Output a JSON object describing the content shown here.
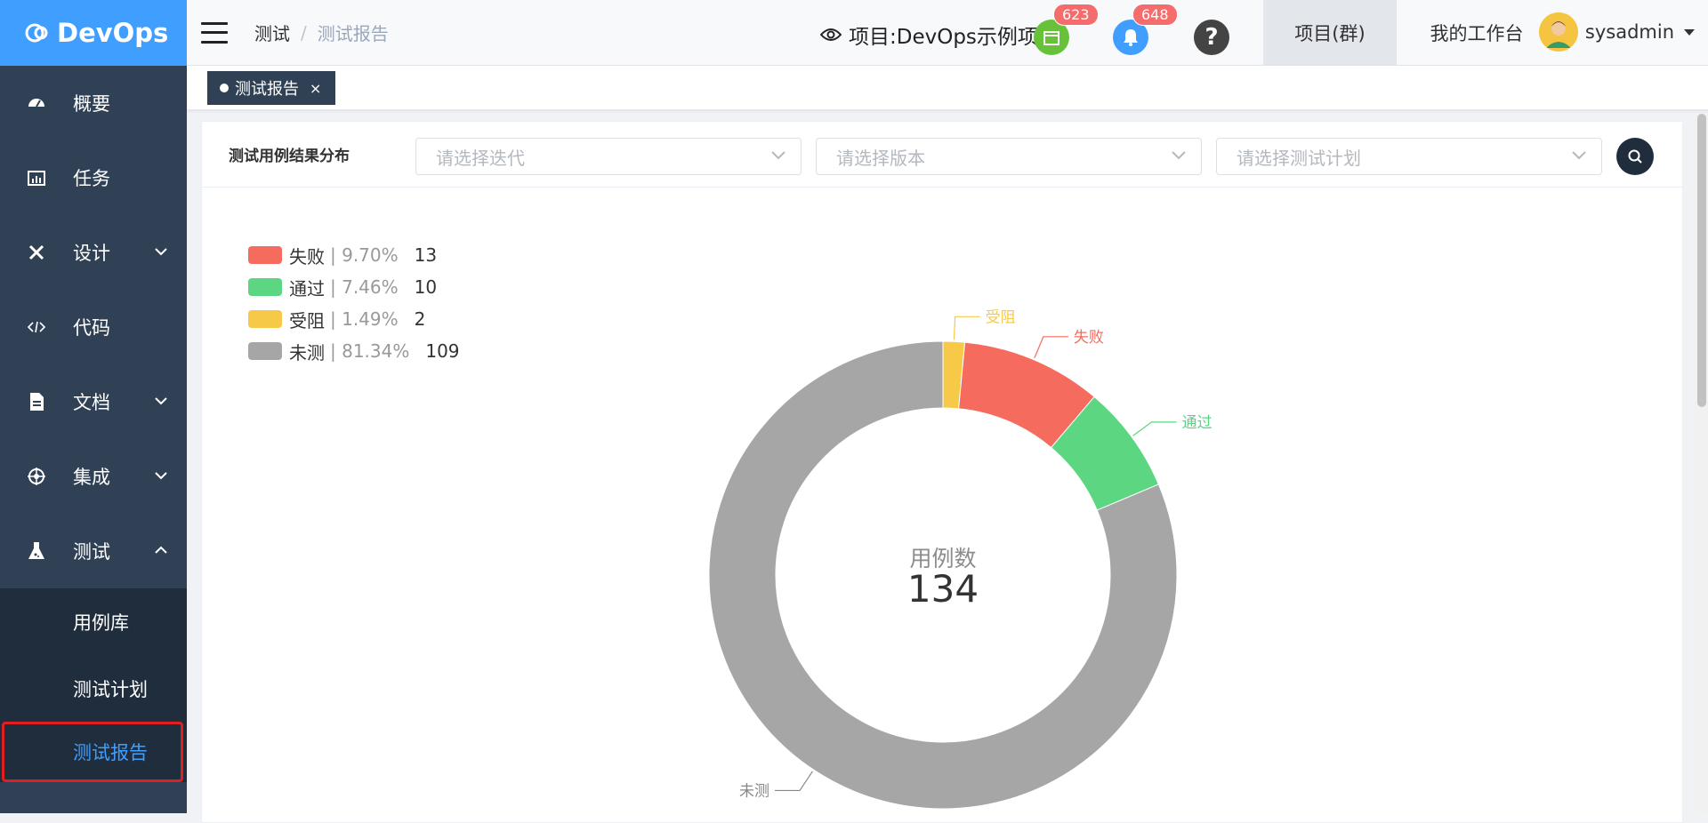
{
  "app": {
    "name": "DevOps"
  },
  "sidebar": {
    "items": [
      {
        "label": "概要",
        "icon": "dashboard-icon"
      },
      {
        "label": "任务",
        "icon": "task-icon"
      },
      {
        "label": "设计",
        "icon": "design-icon"
      },
      {
        "label": "代码",
        "icon": "code-icon"
      },
      {
        "label": "文档",
        "icon": "document-icon"
      },
      {
        "label": "集成",
        "icon": "integration-icon"
      },
      {
        "label": "测试",
        "icon": "flask-icon"
      }
    ],
    "test_submenu": [
      {
        "label": "用例库"
      },
      {
        "label": "测试计划"
      },
      {
        "label": "测试报告"
      }
    ]
  },
  "header": {
    "breadcrumb": [
      "测试",
      "测试报告"
    ],
    "project_prefix": "项目:",
    "project_name": "DevOps示例项目",
    "messages_badge": "623",
    "notifications_badge": "648",
    "project_group_label": "项目(群)",
    "workbench_label": "我的工作台",
    "username": "sysadmin"
  },
  "tabs": [
    {
      "label": "测试报告"
    }
  ],
  "panel": {
    "title": "测试用例结果分布",
    "iteration_placeholder": "请选择迭代",
    "version_placeholder": "请选择版本",
    "plan_placeholder": "请选择测试计划"
  },
  "chart_data": {
    "type": "pie",
    "center_label": "用例数",
    "center_value": "134",
    "slices": [
      {
        "name": "受阻",
        "value": 2,
        "percent": "1.49%",
        "color": "#f7c948"
      },
      {
        "name": "失败",
        "value": 13,
        "percent": "9.70%",
        "color": "#f56b5e"
      },
      {
        "name": "通过",
        "value": 10,
        "percent": "7.46%",
        "color": "#5cd681"
      },
      {
        "name": "未测",
        "value": 109,
        "percent": "81.34%",
        "color": "#a6a6a6"
      }
    ],
    "legend_order": [
      "失败",
      "通过",
      "受阻",
      "未测"
    ],
    "legend_placement": "top-left"
  }
}
